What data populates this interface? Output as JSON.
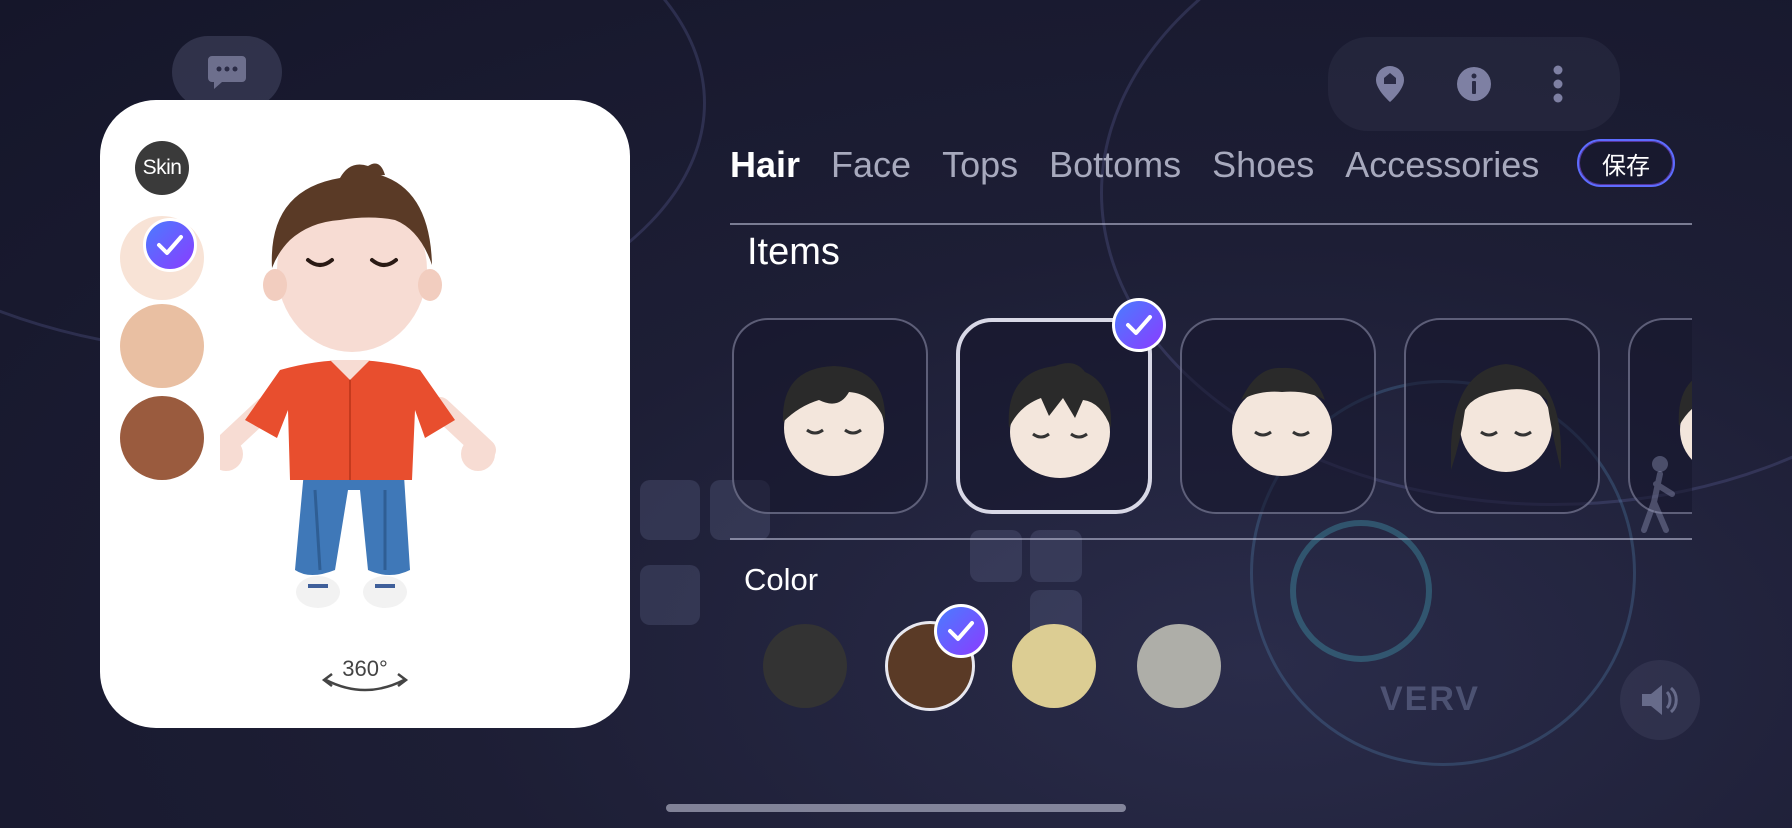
{
  "background": {
    "logo_text": "VERV"
  },
  "top_controls": {
    "chat_icon": "chat-bubble-icon",
    "location_icon": "location-pin-icon",
    "info_icon": "info-icon",
    "more_icon": "more-vertical-icon"
  },
  "avatar_panel": {
    "skin_label": "Skin",
    "skin_swatches": [
      {
        "color": "#f8e3d6",
        "selected": true
      },
      {
        "color": "#e9bfa2",
        "selected": false
      },
      {
        "color": "#9a5b3e",
        "selected": false
      }
    ],
    "rotate_label": "360°"
  },
  "tabs": [
    {
      "label": "Hair",
      "active": true
    },
    {
      "label": "Face",
      "active": false
    },
    {
      "label": "Tops",
      "active": false
    },
    {
      "label": "Bottoms",
      "active": false
    },
    {
      "label": "Shoes",
      "active": false
    },
    {
      "label": "Accessories",
      "active": false
    }
  ],
  "save_label": "保存",
  "items_section": {
    "title": "Items",
    "items": [
      {
        "style": "short-fringe",
        "selected": false
      },
      {
        "style": "messy-spiky",
        "selected": true
      },
      {
        "style": "crew-cut",
        "selected": false
      },
      {
        "style": "long-bob",
        "selected": false
      },
      {
        "style": "partial",
        "selected": false
      }
    ]
  },
  "color_section": {
    "title": "Color",
    "colors": [
      {
        "color": "#333333",
        "selected": false
      },
      {
        "color": "#5a3a26",
        "selected": true
      },
      {
        "color": "#dccd93",
        "selected": false
      },
      {
        "color": "#aeaea8",
        "selected": false
      }
    ]
  },
  "colors": {
    "accent_gradient_start": "#4a7cff",
    "accent_gradient_end": "#8a3cff",
    "panel_bg": "#ffffff"
  }
}
